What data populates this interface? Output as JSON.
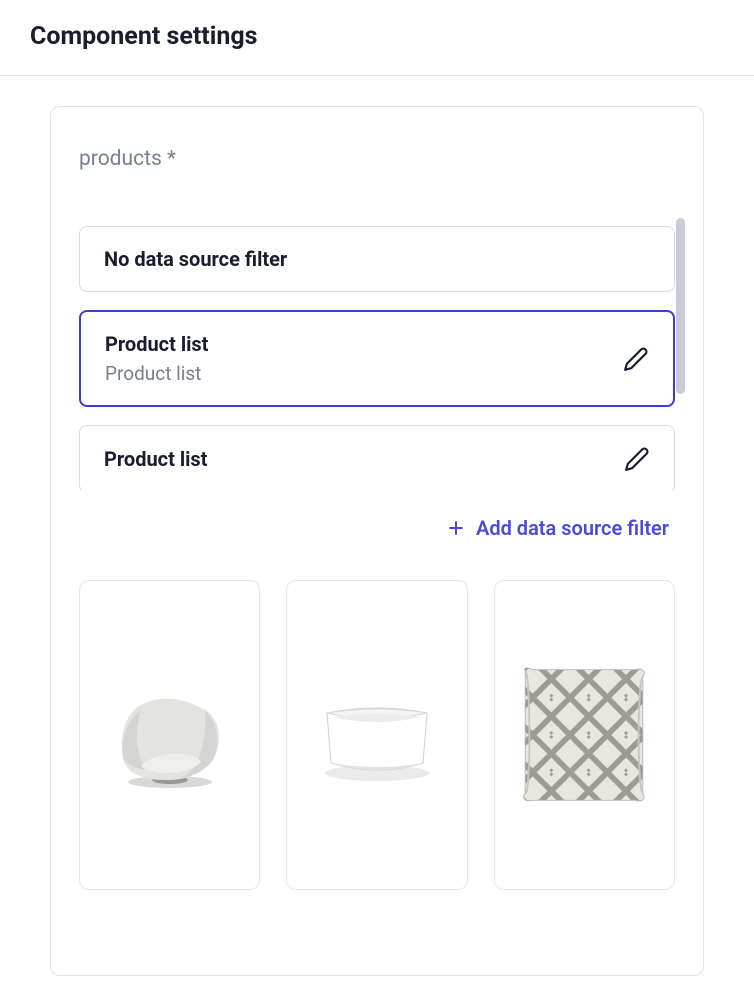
{
  "header": {
    "title": "Component settings"
  },
  "panel": {
    "field_label": "products *",
    "options": [
      {
        "title": "No data source filter",
        "subtitle": "",
        "editable": false
      },
      {
        "title": "Product list",
        "subtitle": "Product list",
        "editable": true,
        "selected": true
      },
      {
        "title": "Product list",
        "subtitle": "",
        "editable": true
      }
    ],
    "add_filter_label": "Add data source filter"
  },
  "products": [
    {
      "name": "chair"
    },
    {
      "name": "bowl"
    },
    {
      "name": "pillow"
    }
  ]
}
